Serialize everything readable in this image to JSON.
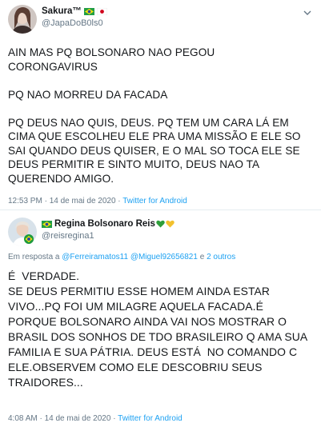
{
  "tweets": [
    {
      "author": {
        "name": "Sakura™",
        "handle": "@JapaDoB0ls0",
        "flags": [
          "brazil-flag",
          "japan-flag"
        ]
      },
      "paragraphs": [
        "AIN MAS PQ BOLSONARO NAO PEGOU\nCORONGAVIRUS",
        "PQ NAO MORREU DA FACADA",
        "PQ DEUS NAO QUIS, DEUS. PQ TEM UM CARA LÁ EM\nCIMA QUE ESCOLHEU ELE PRA UMA MISSÃO E ELE SO\nSAI QUANDO DEUS QUISER, E O MAL SO TOCA ELE SE\nDEUS PERMITIR E SINTO MUITO, DEUS NAO TA\nQUERENDO AMIGO."
      ],
      "timestamp": "12:53 PM · 14 de mai de 2020",
      "separator": " · ",
      "source": "Twitter for Android"
    },
    {
      "author": {
        "name": "Regina Bolsonaro Reis",
        "handle": "@reisregina1",
        "flags": [
          "brazil-flag"
        ],
        "hearts": [
          "#2e9e3a",
          "#f2c12e"
        ]
      },
      "reply": {
        "prefix": "Em resposta a ",
        "mention1": "@Ferreiramatos11",
        "mention2": "@Miguel92656821",
        "conj": " e ",
        "others": "2 outros"
      },
      "paragraphs": [
        "É  VERDADE.\nSE DEUS PERMITIU ESSE HOMEM AINDA ESTAR\nVIVO...PQ FOI UM MILAGRE AQUELA FACADA.É\nPORQUE BOLSONARO AINDA VAI NOS MOSTRAR O\nBRASIL DOS SONHOS DE TDO BRASILEIRO Q AMA SUA\nFAMILIA E SUA PÁTRIA. DEUS ESTÁ  NO COMANDO C\nELE.OBSERVEM COMO ELE DESCOBRIU SEUS\nTRAIDORES..."
      ],
      "timestamp": "4:08 AM · 14 de mai de 2020",
      "separator": " · ",
      "source": "Twitter for Android"
    }
  ],
  "colors": {
    "link": "#1da1f2",
    "muted": "#657786",
    "text": "#14171a",
    "divider": "#e6ecf0"
  }
}
